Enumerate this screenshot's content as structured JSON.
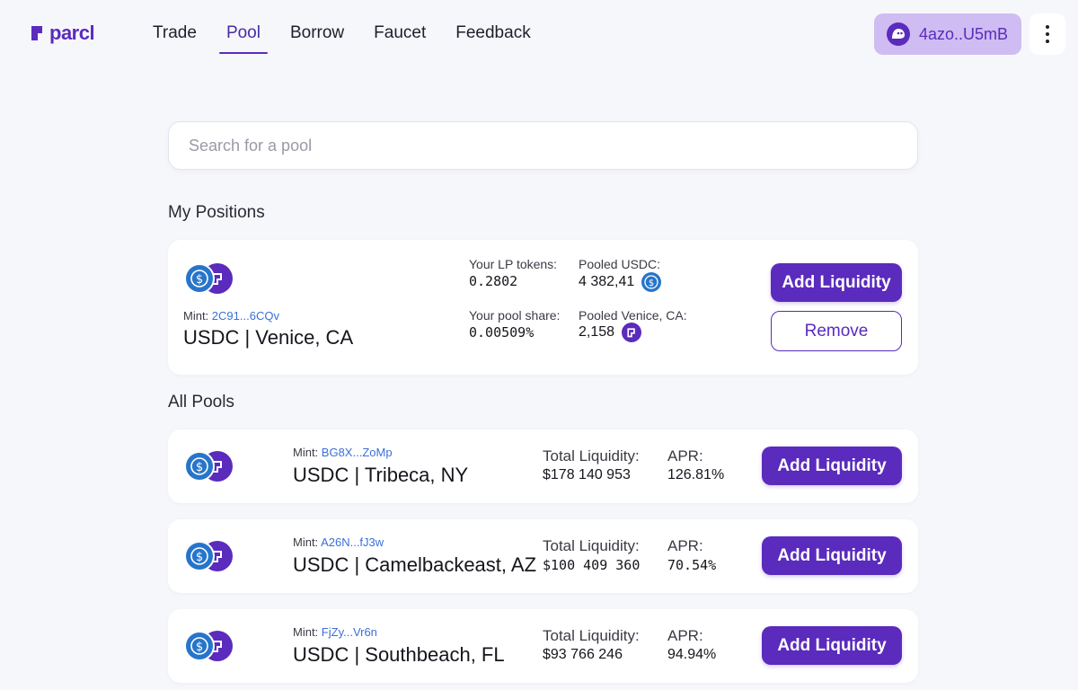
{
  "header": {
    "logo_text": "parcl",
    "nav": [
      {
        "label": "Trade",
        "active": false
      },
      {
        "label": "Pool",
        "active": true
      },
      {
        "label": "Borrow",
        "active": false
      },
      {
        "label": "Faucet",
        "active": false
      },
      {
        "label": "Feedback",
        "active": false
      }
    ],
    "wallet_address": "4azo..U5mB",
    "menu_icon": "more-vertical-icon"
  },
  "search": {
    "placeholder": "Search for a pool",
    "value": ""
  },
  "my_positions": {
    "title": "My Positions",
    "position": {
      "mint_label": "Mint:",
      "mint_address": "2C91...6CQv",
      "pair": "USDC | Venice, CA",
      "lp_tokens_label": "Your LP tokens:",
      "lp_tokens_value": "0.2802",
      "pooled_usdc_label": "Pooled USDC:",
      "pooled_usdc_value": "4 382,41",
      "pool_share_label": "Your pool share:",
      "pool_share_value": "0.00509%",
      "pooled_asset_label": "Pooled Venice, CA:",
      "pooled_asset_value": "2,158",
      "add_label": "Add Liquidity",
      "remove_label": "Remove"
    }
  },
  "all_pools": {
    "title": "All Pools",
    "pools": [
      {
        "mint_label": "Mint:",
        "mint_address": "BG8X...ZoMp",
        "pair": "USDC | Tribeca, NY",
        "liquidity_label": "Total Liquidity:",
        "liquidity_value": "$178 140 953",
        "apr_label": "APR:",
        "apr_value": "126.81%",
        "add_label": "Add Liquidity"
      },
      {
        "mint_label": "Mint:",
        "mint_address": "A26N...fJ3w",
        "pair": "USDC | Camelbackeast, AZ",
        "liquidity_label": "Total Liquidity:",
        "liquidity_value": "$100 409 360",
        "apr_label": "APR:",
        "apr_value": "70.54%",
        "add_label": "Add Liquidity"
      },
      {
        "mint_label": "Mint:",
        "mint_address": "FjZy...Vr6n",
        "pair": "USDC | Southbeach, FL",
        "liquidity_label": "Total Liquidity:",
        "liquidity_value": "$93 766 246",
        "apr_label": "APR:",
        "apr_value": "94.94%",
        "add_label": "Add Liquidity"
      }
    ]
  },
  "colors": {
    "brand": "#5a2bbd",
    "usdc": "#2775ca",
    "wallet_bg": "#cfbcf2",
    "mint_link": "#3b6fd8"
  }
}
